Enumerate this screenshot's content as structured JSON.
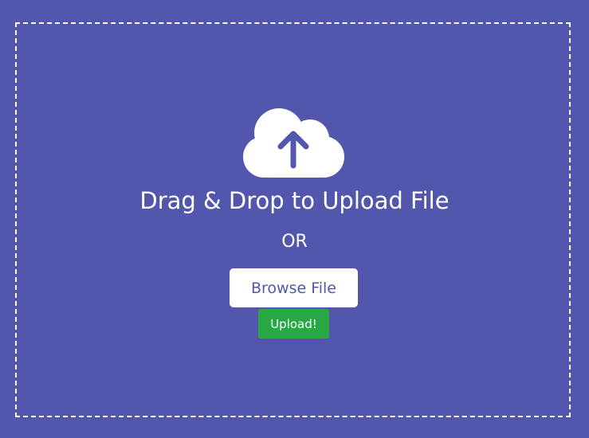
{
  "drop_zone": {
    "icon": "cloud-upload-icon",
    "title": "Drag & Drop to Upload File",
    "or_text": "OR",
    "browse_label": "Browse File",
    "upload_label": "Upload!"
  },
  "colors": {
    "background": "#5256ad",
    "text": "#ffffff",
    "browse_button_bg": "#ffffff",
    "browse_button_text": "#5256ad",
    "upload_button_bg": "#28a745"
  }
}
